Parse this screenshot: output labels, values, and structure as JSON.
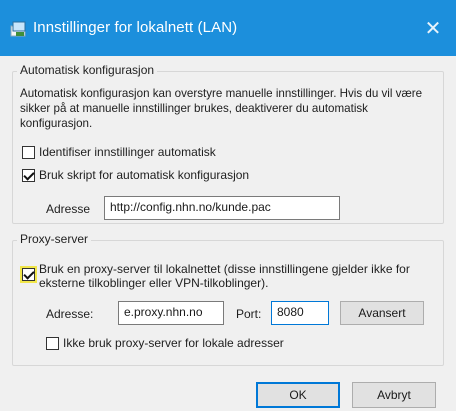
{
  "window": {
    "title": "Innstillinger for lokalnett (LAN)",
    "accent_color": "#1c8fdc",
    "icon": "network-settings-icon",
    "close_symbol": "✕"
  },
  "auto_config": {
    "legend": "Automatisk konfigurasjon",
    "description": "Automatisk konfigurasjon kan overstyre manuelle innstillinger. Hvis du vil være sikker på at manuelle innstillinger brukes, deaktiverer du automatisk konfigurasjon.",
    "detect_label": "Identifiser innstillinger automatisk",
    "detect_checked": false,
    "script_label": "Bruk skript for automatisk konfigurasjon",
    "script_checked": true,
    "address_label": "Adresse",
    "address_value": "http://config.nhn.no/kunde.pac"
  },
  "proxy": {
    "legend": "Proxy-server",
    "use_proxy_label": "Bruk en proxy-server til lokalnettet (disse innstillingene gjelder ikke for eksterne tilkoblinger eller VPN-tilkoblinger).",
    "use_proxy_checked": true,
    "address_label": "Adresse:",
    "address_value": "e.proxy.nhn.no",
    "port_label": "Port:",
    "port_value": "8080",
    "advanced_label": "Avansert",
    "bypass_label": "Ikke bruk proxy-server for lokale adresser",
    "bypass_checked": false
  },
  "footer": {
    "ok_label": "OK",
    "cancel_label": "Avbryt"
  }
}
